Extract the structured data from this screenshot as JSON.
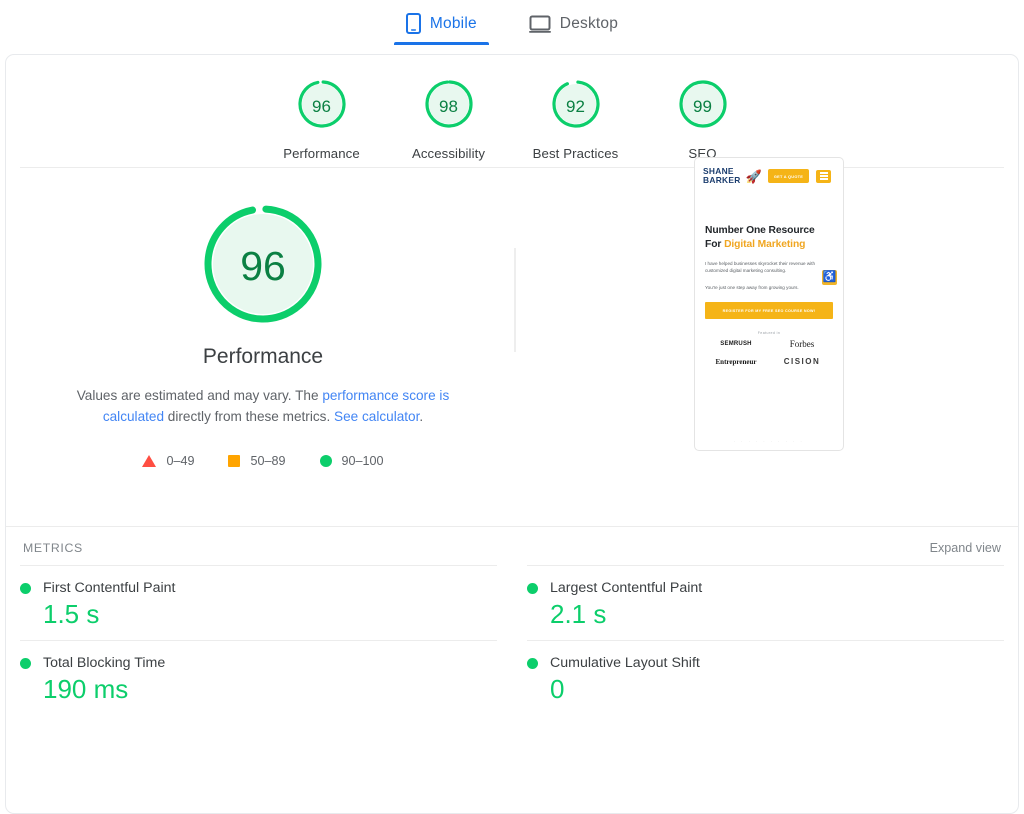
{
  "tabs": [
    {
      "id": "mobile",
      "label": "Mobile",
      "icon": "mobile-phone-icon",
      "active": true
    },
    {
      "id": "desktop",
      "label": "Desktop",
      "icon": "desktop-monitor-icon",
      "active": false
    }
  ],
  "category_scores": [
    {
      "label": "Performance",
      "value": "96"
    },
    {
      "label": "Accessibility",
      "value": "98"
    },
    {
      "label": "Best Practices",
      "value": "92"
    },
    {
      "label": "SEO",
      "value": "99"
    }
  ],
  "performance": {
    "score": "96",
    "title": "Performance",
    "desc_part1": "Values are estimated and may vary. The ",
    "link1": "performance score is calculated",
    "desc_part2": " directly from these metrics. ",
    "link2": "See calculator",
    "desc_part3": "."
  },
  "legend": [
    {
      "shape": "triangle",
      "color": "#ff4e42",
      "range": "0–49"
    },
    {
      "shape": "square",
      "color": "#ffa400",
      "range": "50–89"
    },
    {
      "shape": "circle",
      "color": "#0cce6b",
      "range": "90–100"
    }
  ],
  "thumbnail": {
    "logo_line1": "SHANE",
    "logo_line2": "BARKER",
    "rocket_icon": "rocket-icon",
    "quote_button": "GET A QUOTE",
    "menu_icon": "hamburger-menu-icon",
    "heading_part1": "Number One Resource For ",
    "heading_highlight": "Digital Marketing",
    "paragraph1": "I have helped businesses skyrocket their revenue with customized digital marketing consulting.",
    "paragraph2": "You're just one step away from growing yours.",
    "cta_button": "REGISTER FOR MY FREE SEO COURSE NOW!",
    "featured_label": "Featured in",
    "brands": [
      "SEMRUSH",
      "Forbes",
      "Entrepreneur",
      "CISION"
    ],
    "accessibility_icon": "wheelchair-accessibility-icon",
    "carousel_dots": ". . . . . . . . . ."
  },
  "metrics_section": {
    "title": "METRICS",
    "expand_label": "Expand view",
    "items": [
      {
        "name": "First Contentful Paint",
        "value": "1.5 s",
        "status_color": "#0cce6b"
      },
      {
        "name": "Largest Contentful Paint",
        "value": "2.1 s",
        "status_color": "#0cce6b"
      },
      {
        "name": "Total Blocking Time",
        "value": "190 ms",
        "status_color": "#0cce6b"
      },
      {
        "name": "Cumulative Layout Shift",
        "value": "0",
        "status_color": "#0cce6b"
      }
    ]
  },
  "colors": {
    "pass_green": "#0cce6b",
    "average_orange": "#ffa400",
    "fail_red": "#ff4e42",
    "link_blue": "#4285f4",
    "accent_blue": "#1a73e8"
  }
}
